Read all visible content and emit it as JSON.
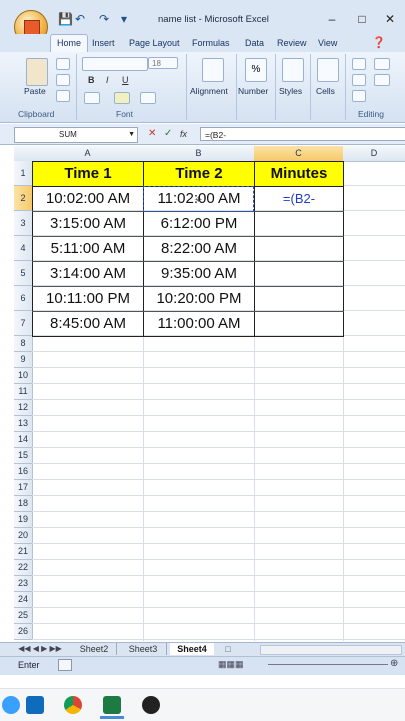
{
  "window": {
    "title": "name list - Microsoft Excel",
    "minimize": "–",
    "maximize": "□",
    "close": "✕"
  },
  "ribbon": {
    "tabs": [
      "Home",
      "Insert",
      "Page Layout",
      "Formulas",
      "Data",
      "Review",
      "View"
    ],
    "groups": {
      "clipboard": "Clipboard",
      "font": "Font",
      "editing": "Editing"
    },
    "buttons": {
      "paste": "Paste",
      "alignment": "Alignment",
      "number": "Number",
      "styles": "Styles",
      "cells": "Cells",
      "bold": "B",
      "italic": "I",
      "underline": "U",
      "font_size": "18"
    }
  },
  "formula_bar": {
    "name_box": "SUM",
    "fx": "fx",
    "formula": "=(B2-"
  },
  "grid": {
    "columns": [
      "A",
      "B",
      "C",
      "D"
    ],
    "rows": [
      "1",
      "2",
      "3",
      "4",
      "5",
      "6",
      "7",
      "8",
      "9",
      "10",
      "11",
      "12",
      "13",
      "14",
      "15",
      "16",
      "17",
      "18",
      "19",
      "20",
      "21",
      "22",
      "23",
      "24",
      "25",
      "26"
    ],
    "headers": [
      "Time 1",
      "Time 2",
      "Minutes"
    ],
    "data": [
      [
        "10:02:00 AM",
        "11:02:00 AM"
      ],
      [
        "3:15:00 AM",
        "6:12:00 PM"
      ],
      [
        "5:11:00 AM",
        "8:22:00 AM"
      ],
      [
        "3:14:00 AM",
        "9:35:00 AM"
      ],
      [
        "10:11:00 PM",
        "10:20:00 PM"
      ],
      [
        "8:45:00 AM",
        "11:00:00 AM"
      ]
    ],
    "editing_cell": "=(B2-"
  },
  "sheets": {
    "tabs": [
      "Sheet2",
      "Sheet3",
      "Sheet4"
    ],
    "active": "Sheet4"
  },
  "status": {
    "mode": "Enter"
  },
  "colors": {
    "header_fill": "#ffff00",
    "ribbon": "#dbe6f4"
  }
}
